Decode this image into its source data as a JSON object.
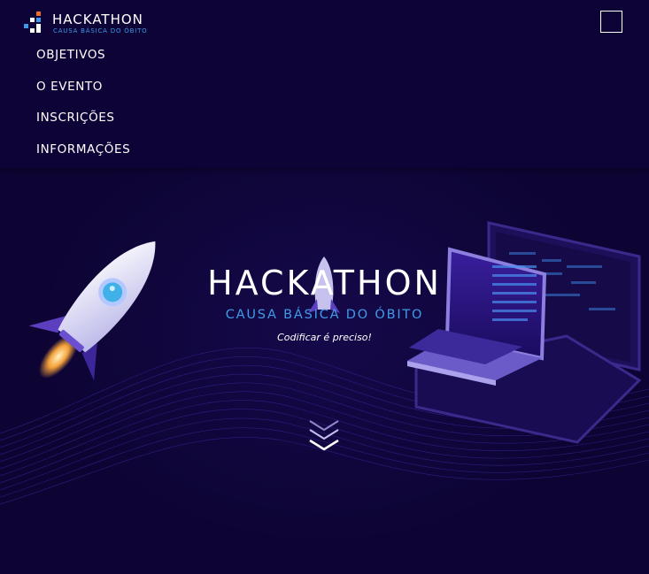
{
  "brand": {
    "title": "HACKATHON",
    "subtitle": "CAUSA BÁSICA DO ÓBITO"
  },
  "nav": {
    "items": [
      "OBJETIVOS",
      "O EVENTO",
      "INSCRIÇÕES",
      "INFORMAÇÕES"
    ]
  },
  "hero": {
    "title": "HACKATHON",
    "subtitle": "CAUSA BÁSICA DO ÓBITO",
    "tagline": "Codificar é preciso!"
  },
  "icons": {
    "menu": "hamburger-menu-icon",
    "scroll": "double-chevron-down-icon",
    "logo": "pixel-grid-logo-icon"
  },
  "colors": {
    "background": "#0e0336",
    "accent_blue": "#3f9be8",
    "logo_orange": "#f26a2e",
    "text": "#ffffff"
  }
}
